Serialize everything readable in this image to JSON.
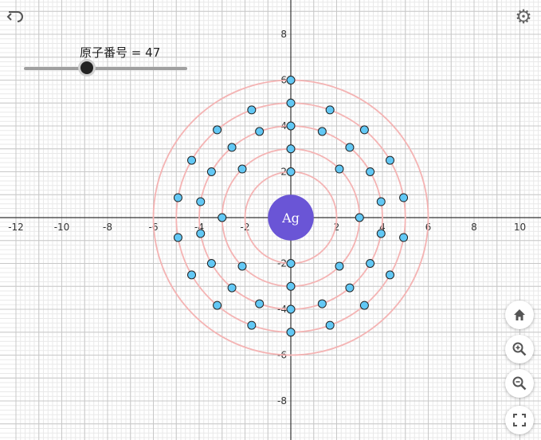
{
  "slider": {
    "label": "原子番号",
    "equals": "=",
    "value": "47",
    "min": 1,
    "max": 118
  },
  "element_symbol": "Ag",
  "shells": [
    2,
    8,
    18,
    18,
    1
  ],
  "axes": {
    "x_ticks": [
      "-12",
      "-10",
      "-8",
      "-6",
      "-4",
      "-2",
      "2",
      "4",
      "6",
      "8",
      "10"
    ],
    "x_tick_values": [
      -12,
      -10,
      -8,
      -6,
      -4,
      -2,
      2,
      4,
      6,
      8,
      10
    ],
    "y_ticks": [
      "8",
      "6",
      "4",
      "2",
      "-2",
      "-4",
      "-6",
      "-8"
    ],
    "y_tick_values": [
      8,
      6,
      4,
      2,
      -2,
      -4,
      -6,
      -8
    ],
    "origin": "0"
  },
  "colors": {
    "nucleus": "#6a55d6",
    "orbit": "#f4b3b3",
    "electron": "#62c8f5",
    "grid_minor": "#e9e9e9",
    "grid_major": "#c8c8c8",
    "axis": "#333333"
  },
  "icons": {
    "undo": "undo-icon",
    "settings": "gear-icon",
    "home": "home-icon",
    "zoom_in": "zoom-in-icon",
    "zoom_out": "zoom-out-icon",
    "fullscreen": "fullscreen-icon"
  }
}
